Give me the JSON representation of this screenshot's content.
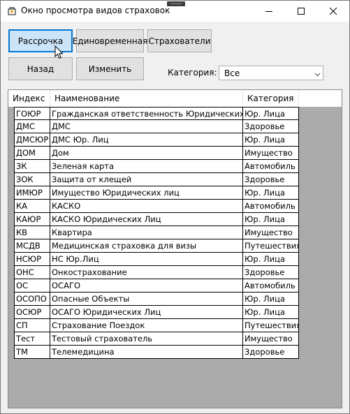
{
  "window": {
    "title": "Окно просмотра видов страховок"
  },
  "buttons": {
    "installment": "Рассрочка",
    "lump_sum": "Единовременная",
    "insurers": "Страхователи",
    "back": "Назад",
    "edit": "Изменить"
  },
  "category_filter": {
    "label": "Категория:",
    "value": "Все"
  },
  "grid": {
    "columns": [
      "Индекс",
      "Наименование",
      "Категория"
    ],
    "rows": [
      [
        "ГОЮР",
        "Гражданская ответственность Юридических лиц",
        "Юр. Лица"
      ],
      [
        "ДМС",
        "ДМС",
        "Здоровье"
      ],
      [
        "ДМСЮР",
        "ДМС Юр. Лиц",
        "Юр. Лица"
      ],
      [
        "ДОМ",
        "Дом",
        "Имущество"
      ],
      [
        "ЗК",
        "Зеленая карта",
        "Автомобиль"
      ],
      [
        "ЗОК",
        "Защита от клещей",
        "Здоровье"
      ],
      [
        "ИМЮР",
        "Имущество Юридических лиц",
        "Юр. Лица"
      ],
      [
        "КА",
        "КАСКО",
        "Автомобиль"
      ],
      [
        "КАЮР",
        "КАСКО Юридических Лиц",
        "Юр. Лица"
      ],
      [
        "КВ",
        "Квартира",
        "Имущество"
      ],
      [
        "МСДВ",
        "Медицинская страховка для визы",
        "Путешествия"
      ],
      [
        "НСЮР",
        "НС Юр.Лиц",
        "Юр. Лица"
      ],
      [
        "ОНС",
        "Онкострахование",
        "Здоровье"
      ],
      [
        "ОС",
        "ОСАГО",
        "Автомобиль"
      ],
      [
        "ОСОПО",
        "Опасные Объекты",
        "Юр. Лица"
      ],
      [
        "ОСЮР",
        "ОСАГО Юридических Лиц",
        "Юр. Лица"
      ],
      [
        "СП",
        "Страхование Поездок",
        "Путешествия"
      ],
      [
        "Тест",
        "Тестовый страхователь",
        "Имущество"
      ],
      [
        "ТМ",
        "Телемедицина",
        "Здоровье"
      ]
    ]
  },
  "icons": {
    "app": "app-icon",
    "minimize": "minimize-icon",
    "maximize": "maximize-icon",
    "close": "close-icon",
    "combo_arrow": "chevron-down-icon",
    "cursor": "mouse-pointer-icon"
  },
  "colors": {
    "active_button_bg": "#cce4f7",
    "active_button_border": "#0078d7"
  }
}
